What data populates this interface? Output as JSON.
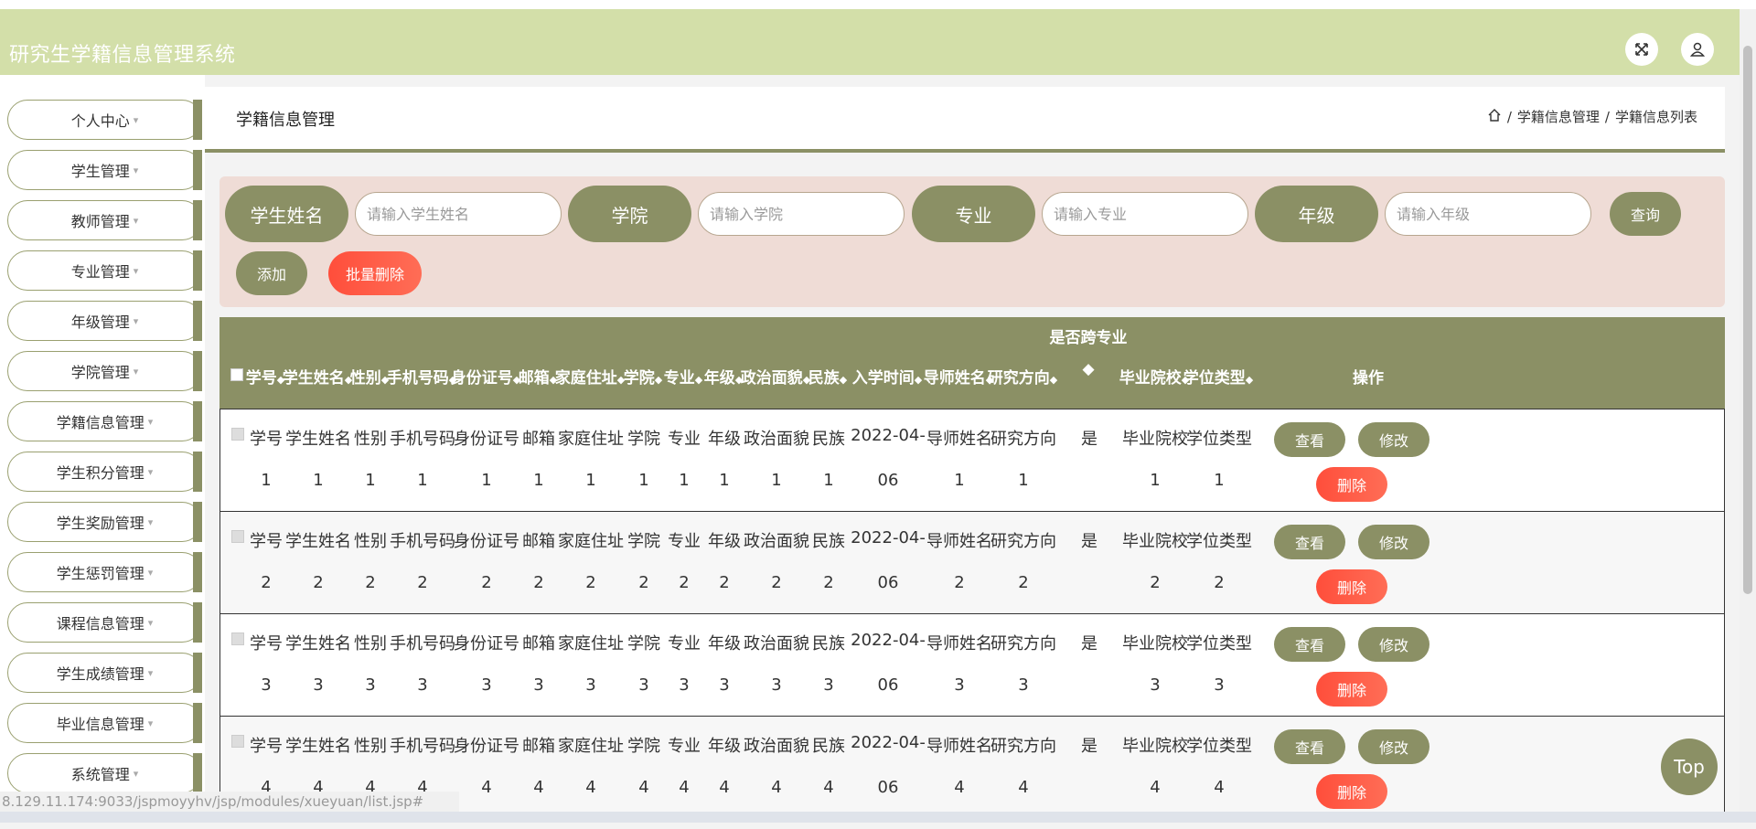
{
  "app": {
    "title": "研究生学籍信息管理系统"
  },
  "header_icons": [
    "fullscreen-icon",
    "user-icon"
  ],
  "sidebar": {
    "items": [
      {
        "label": "个人中心"
      },
      {
        "label": "学生管理"
      },
      {
        "label": "教师管理"
      },
      {
        "label": "专业管理"
      },
      {
        "label": "年级管理"
      },
      {
        "label": "学院管理"
      },
      {
        "label": "学籍信息管理"
      },
      {
        "label": "学生积分管理"
      },
      {
        "label": "学生奖励管理"
      },
      {
        "label": "学生惩罚管理"
      },
      {
        "label": "课程信息管理"
      },
      {
        "label": "学生成绩管理"
      },
      {
        "label": "毕业信息管理"
      },
      {
        "label": "系统管理"
      }
    ],
    "caret": "▾"
  },
  "page": {
    "title": "学籍信息管理",
    "breadcrumb": [
      "学籍信息管理",
      "学籍信息列表"
    ],
    "separator": "/"
  },
  "search": {
    "fields": [
      {
        "label": "学生姓名",
        "placeholder": "请输入学生姓名"
      },
      {
        "label": "学院",
        "placeholder": "请输入学院"
      },
      {
        "label": "专业",
        "placeholder": "请输入专业"
      },
      {
        "label": "年级",
        "placeholder": "请输入年级"
      }
    ],
    "query_button": "查询",
    "add_button": "添加",
    "batch_delete_button": "批量删除"
  },
  "table": {
    "headers": [
      "学号",
      "学生姓名",
      "性别",
      "手机号码",
      "身份证号",
      "邮箱",
      "家庭住址",
      "学院",
      "专业",
      "年级",
      "政治面貌",
      "民族",
      "入学时间",
      "导师姓名",
      "研究方向",
      "是否跨专业",
      "毕业院校",
      "学位类型",
      "操作"
    ],
    "sort_glyph": "◆",
    "rows": [
      {
        "cells": [
          "学号",
          "学生姓名",
          "性别",
          "手机号码",
          "身份证号",
          "邮箱",
          "家庭住址",
          "学院",
          "专业",
          "年级",
          "政治面貌",
          "民族",
          "2022-04-",
          "导师姓名",
          "研究方向",
          "是",
          "毕业院校",
          "学位类型"
        ],
        "line2": [
          "1",
          "1",
          "1",
          "1",
          "1",
          "1",
          "1",
          "1",
          "1",
          "1",
          "1",
          "1",
          "06",
          "1",
          "1",
          "",
          "1",
          "1"
        ]
      },
      {
        "cells": [
          "学号",
          "学生姓名",
          "性别",
          "手机号码",
          "身份证号",
          "邮箱",
          "家庭住址",
          "学院",
          "专业",
          "年级",
          "政治面貌",
          "民族",
          "2022-04-",
          "导师姓名",
          "研究方向",
          "是",
          "毕业院校",
          "学位类型"
        ],
        "line2": [
          "2",
          "2",
          "2",
          "2",
          "2",
          "2",
          "2",
          "2",
          "2",
          "2",
          "2",
          "2",
          "06",
          "2",
          "2",
          "",
          "2",
          "2"
        ]
      },
      {
        "cells": [
          "学号",
          "学生姓名",
          "性别",
          "手机号码",
          "身份证号",
          "邮箱",
          "家庭住址",
          "学院",
          "专业",
          "年级",
          "政治面貌",
          "民族",
          "2022-04-",
          "导师姓名",
          "研究方向",
          "是",
          "毕业院校",
          "学位类型"
        ],
        "line2": [
          "3",
          "3",
          "3",
          "3",
          "3",
          "3",
          "3",
          "3",
          "3",
          "3",
          "3",
          "3",
          "06",
          "3",
          "3",
          "",
          "3",
          "3"
        ]
      },
      {
        "cells": [
          "学号",
          "学生姓名",
          "性别",
          "手机号码",
          "身份证号",
          "邮箱",
          "家庭住址",
          "学院",
          "专业",
          "年级",
          "政治面貌",
          "民族",
          "2022-04-",
          "导师姓名",
          "研究方向",
          "是",
          "毕业院校",
          "学位类型"
        ],
        "line2": [
          "4",
          "4",
          "4",
          "4",
          "4",
          "4",
          "4",
          "4",
          "4",
          "4",
          "4",
          "4",
          "06",
          "4",
          "4",
          "",
          "4",
          "4"
        ]
      }
    ],
    "actions": {
      "view": "查看",
      "edit": "修改",
      "delete": "删除"
    }
  },
  "status_url": "8.129.11.174:9033/jspmoyyhv/jsp/modules/xueyuan/list.jsp#",
  "top_button": "Top",
  "colors": {
    "header_bg": "#d3dfa9",
    "olive": "#8b9065",
    "search_bg": "#efdcd6",
    "danger": "#ff4e3b"
  }
}
